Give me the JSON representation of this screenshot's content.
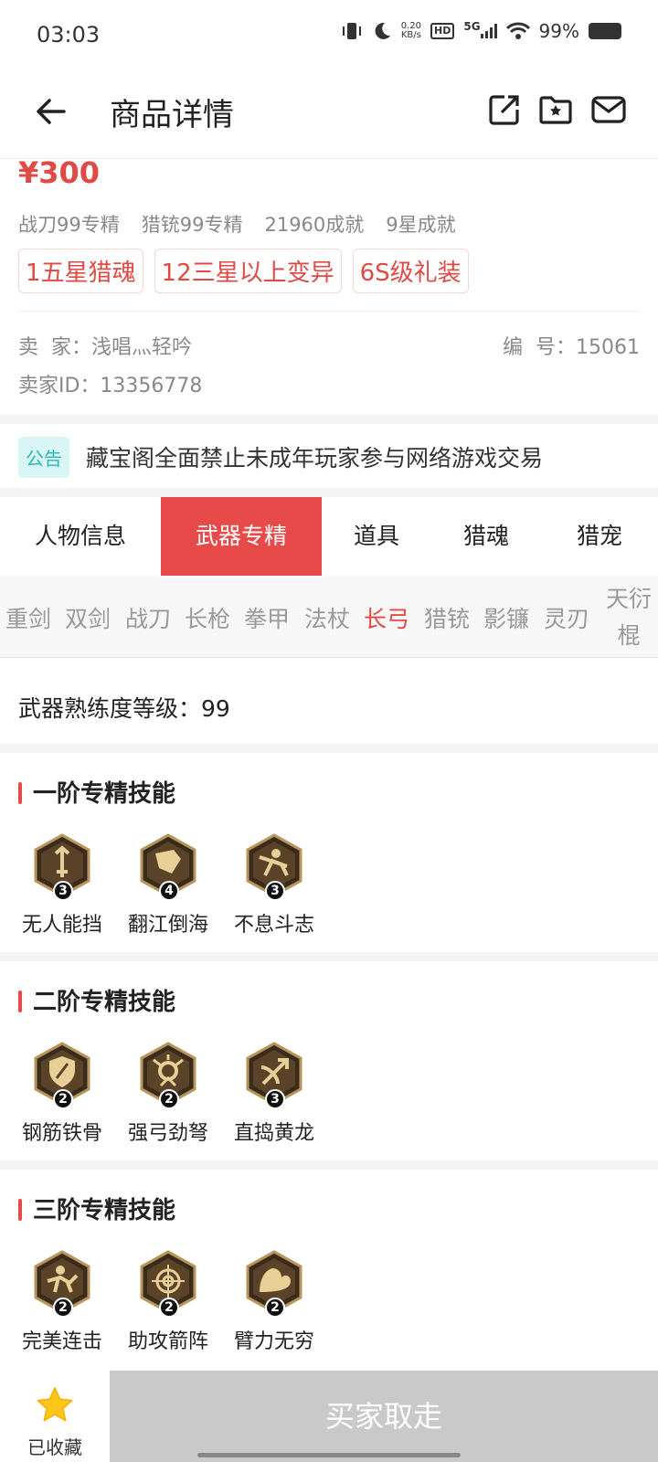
{
  "status": {
    "time": "03:03",
    "speed_top": "0.20",
    "speed_unit": "KB/s",
    "hd": "HD",
    "net": "5G",
    "battery": "99%"
  },
  "header": {
    "title": "商品详情"
  },
  "product": {
    "price": "¥300",
    "stats": [
      "战刀99专精",
      "猎铳99专精",
      "21960成就",
      "9星成就"
    ],
    "tags": [
      "1五星猎魂",
      "12三星以上变异",
      "6S级礼装"
    ],
    "seller": "卖  家：浅唱灬轻吟",
    "serial": "编  号：15061",
    "seller_id": "卖家ID：13356778"
  },
  "notice": {
    "badge": "公告",
    "text": "藏宝阁全面禁止未成年玩家参与网络游戏交易"
  },
  "tabs": [
    "人物信息",
    "武器专精",
    "道具",
    "猎魂",
    "猎宠"
  ],
  "subtabs": [
    "重剑",
    "双剑",
    "战刀",
    "长枪",
    "拳甲",
    "法杖",
    "长弓",
    "猎铳",
    "影镰",
    "灵刃"
  ],
  "subtab_last": {
    "line1": "天衍",
    "line2": "棍"
  },
  "level": "武器熟练度等级：99",
  "sections": [
    {
      "title": "一阶专精技能",
      "skills": [
        {
          "name": "无人能挡",
          "level": "3"
        },
        {
          "name": "翻江倒海",
          "level": "4"
        },
        {
          "name": "不息斗志",
          "level": "3"
        }
      ]
    },
    {
      "title": "二阶专精技能",
      "skills": [
        {
          "name": "钢筋铁骨",
          "level": "2"
        },
        {
          "name": "强弓劲弩",
          "level": "2"
        },
        {
          "name": "直捣黄龙",
          "level": "3"
        }
      ]
    },
    {
      "title": "三阶专精技能",
      "skills": [
        {
          "name": "完美连击",
          "level": "2"
        },
        {
          "name": "助攻箭阵",
          "level": "2"
        },
        {
          "name": "臂力无穷",
          "level": "2"
        }
      ]
    }
  ],
  "bottom": {
    "fav_label": "已收藏",
    "buy_label": "买家取走"
  },
  "colors": {
    "accent": "#e84a4a",
    "price": "#e04a44",
    "notice_bg": "#d9f5f5",
    "notice_fg": "#2db6b6",
    "star": "#ffc61a",
    "buy_bg": "#c9c9c9"
  }
}
